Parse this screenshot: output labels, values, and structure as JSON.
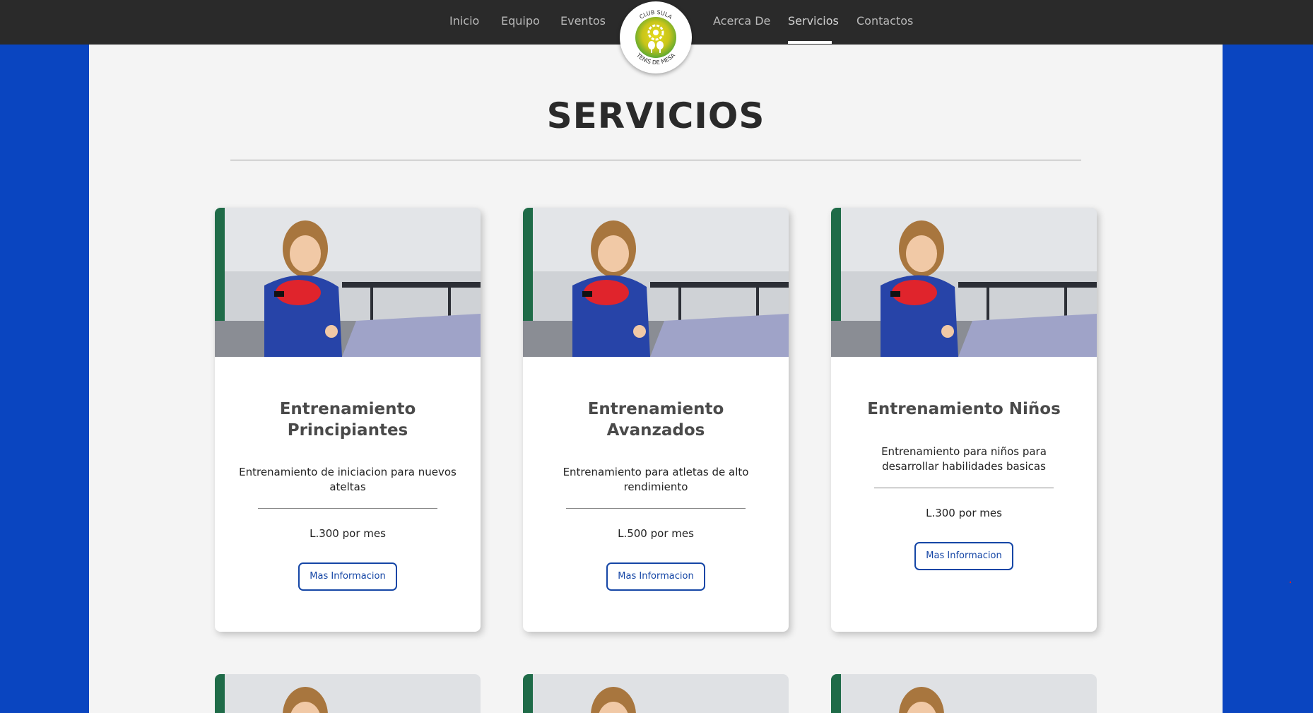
{
  "nav": {
    "items": [
      "Inicio",
      "Equipo",
      "Eventos",
      "Acerca De",
      "Servicios",
      "Contactos"
    ],
    "active": "Servicios"
  },
  "logo": {
    "top_text": "CLUB SULA",
    "bottom_text": "TENIS DE MESA"
  },
  "page": {
    "title": "SERVICIOS"
  },
  "cards": [
    {
      "title_line1": "Entrenamiento",
      "title_line2": "Principiantes",
      "description": "Entrenamiento de iniciacion para nuevos ateltas",
      "price": "L.300 por mes",
      "button": "Mas Informacion"
    },
    {
      "title_line1": "Entrenamiento",
      "title_line2": "Avanzados",
      "description": "Entrenamiento para atletas de alto rendimiento",
      "price": "L.500 por mes",
      "button": "Mas Informacion"
    },
    {
      "title_line1": "Entrenamiento Niños",
      "title_line2": "",
      "description": "Entrenamiento para niños para desarrollar habilidades basicas",
      "price": "L.300 por mes",
      "button": "Mas Informacion"
    }
  ],
  "colors": {
    "page_background": "#0a45c0",
    "navbar": "#2a2a2a",
    "content_background": "#f4f4f4",
    "button_accent": "#1546a6",
    "logo_yellow": "#d4c814",
    "logo_green": "#5aa832"
  }
}
